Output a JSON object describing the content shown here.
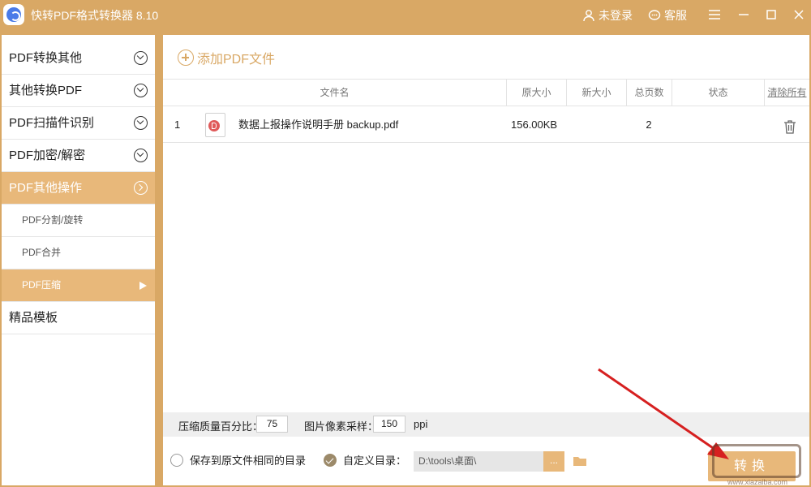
{
  "app": {
    "title": "快转PDF格式转换器 8.10",
    "login_label": "未登录",
    "service_label": "客服"
  },
  "sidebar": {
    "items": [
      {
        "label": "PDF转换其他"
      },
      {
        "label": "其他转换PDF"
      },
      {
        "label": "PDF扫描件识别"
      },
      {
        "label": "PDF加密/解密"
      },
      {
        "label": "PDF其他操作"
      }
    ],
    "subitems": [
      {
        "label": "PDF分割/旋转"
      },
      {
        "label": "PDF合并"
      },
      {
        "label": "PDF压缩"
      }
    ],
    "extra_item": {
      "label": "精品模板"
    }
  },
  "main": {
    "add_file_label": "添加PDF文件",
    "columns": {
      "filename": "文件名",
      "original_size": "原大小",
      "new_size": "新大小",
      "total_pages": "总页数",
      "status": "状态",
      "clear_all": "清除所有"
    },
    "rows": [
      {
        "index": "1",
        "filename": "数据上报操作说明手册 backup.pdf",
        "original_size": "156.00KB",
        "new_size": "",
        "total_pages": "2",
        "status": ""
      }
    ]
  },
  "quality": {
    "quality_label": "压缩质量百分比：",
    "quality_value": "75",
    "ppi_label": "图片像素采样：",
    "ppi_value": "150",
    "ppi_unit": "ppi"
  },
  "output": {
    "same_dir_label": "保存到原文件相同的目录",
    "custom_dir_label": "自定义目录：",
    "custom_dir_value": "D:\\tools\\桌面\\",
    "browse_label": "...",
    "convert_label": "转换"
  },
  "watermark": {
    "text": "www.xiazaiba.com"
  },
  "colors": {
    "accent": "#D9A865",
    "active": "#E8B87A",
    "arrow": "#D62020"
  },
  "icons": [
    "app-logo-icon",
    "user-icon",
    "chat-icon",
    "menu-icon",
    "minimize-icon",
    "maximize-icon",
    "close-icon",
    "chevron-down-icon",
    "chevron-right-icon",
    "play-icon",
    "add-circle-icon",
    "pdf-file-icon",
    "trash-icon",
    "folder-icon"
  ]
}
